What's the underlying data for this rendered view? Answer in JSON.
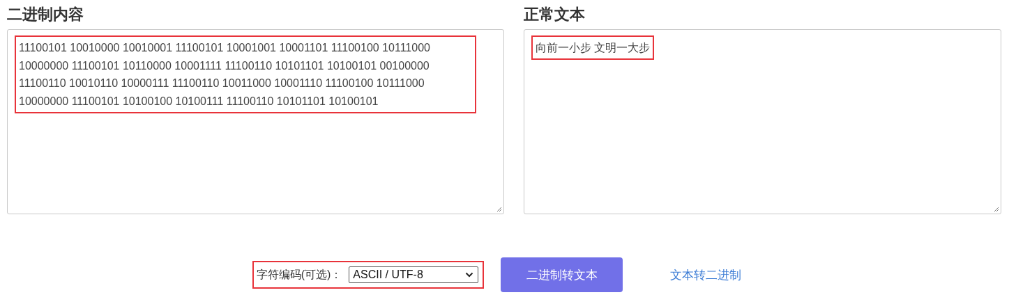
{
  "binary_panel": {
    "heading": "二进制内容",
    "value": "11100101 10010000 10010001 11100101 10001001 10001101 11100100 10111000 10000000 11100101 10110000 10001111 11100110 10101101 10100101 00100000 11100110 10010110 10000111 11100110 10011000 10001110 11100100 10111000 10000000 11100101 10100100 10100111 11100110 10101101 10100101"
  },
  "text_panel": {
    "heading": "正常文本",
    "value": "向前一小步 文明一大步"
  },
  "encoding": {
    "label": "字符编码(可选)：",
    "value": "ASCII / UTF-8"
  },
  "buttons": [
    {
      "label": "二进制转文本",
      "kind": "primary"
    },
    {
      "label": "文本转二进制",
      "kind": "link"
    }
  ]
}
